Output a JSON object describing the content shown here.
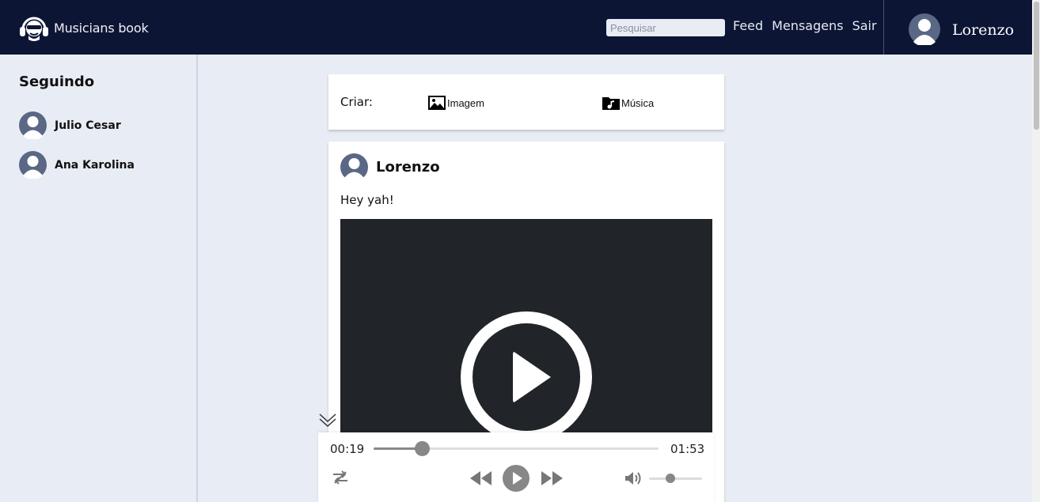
{
  "header": {
    "app_name": "Musicians book",
    "search_placeholder": "Pesquisar",
    "nav": [
      "Feed",
      "Mensagens",
      "Sair"
    ],
    "user_name": "Lorenzo"
  },
  "sidebar": {
    "title": "Seguindo",
    "following": [
      "Julio Cesar",
      "Ana Karolina"
    ]
  },
  "create": {
    "label": "Criar:",
    "image_label": "Imagem",
    "music_label": "Música"
  },
  "post": {
    "author": "Lorenzo",
    "text": "Hey yah!"
  },
  "player": {
    "current_time": "00:19",
    "total_time": "01:53",
    "progress": 0.17,
    "volume": 0.4
  },
  "colors": {
    "header_bg": "#0d1535",
    "page_bg": "#e8ecf4",
    "video_bg": "#212428",
    "avatar_bg": "#5a6785"
  }
}
